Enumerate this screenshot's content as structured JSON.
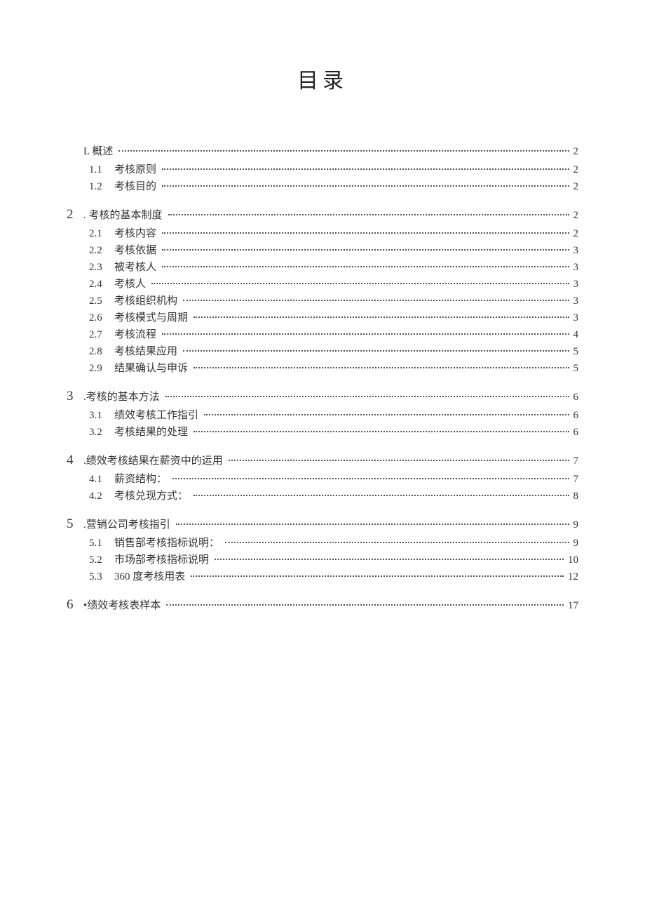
{
  "title": "目录",
  "toc": [
    {
      "level": 1,
      "num": "",
      "label": "L 概述",
      "page": "2"
    },
    {
      "level": 2,
      "num": "1.1",
      "label": "考核原则",
      "page": "2"
    },
    {
      "level": 2,
      "num": "1.2",
      "label": "考核目的",
      "page": "2"
    },
    {
      "level": 1,
      "num": "2",
      "label": ". 考核的基本制度",
      "page": "2"
    },
    {
      "level": 2,
      "num": "2.1",
      "label": "考核内容",
      "page": "2"
    },
    {
      "level": 2,
      "num": "2.2",
      "label": "考核依据",
      "page": "3"
    },
    {
      "level": 2,
      "num": "2.3",
      "label": "被考核人",
      "page": "3"
    },
    {
      "level": 2,
      "num": "2.4",
      "label": "考核人",
      "page": "3"
    },
    {
      "level": 2,
      "num": "2.5",
      "label": "考核组织机构",
      "page": "3"
    },
    {
      "level": 2,
      "num": "2.6",
      "label": "考核模式与周期",
      "page": "3"
    },
    {
      "level": 2,
      "num": "2.7",
      "label": "考核流程",
      "page": "4"
    },
    {
      "level": 2,
      "num": "2.8",
      "label": "考核结果应用",
      "page": "5"
    },
    {
      "level": 2,
      "num": "2.9",
      "label": "结果确认与申诉",
      "page": "5"
    },
    {
      "level": 1,
      "num": "3",
      "label": ".考核的基本方法",
      "page": "6"
    },
    {
      "level": 2,
      "num": "3.1",
      "label": "绩效考核工作指引",
      "page": "6"
    },
    {
      "level": 2,
      "num": "3.2",
      "label": "考核结果的处理",
      "page": "6"
    },
    {
      "level": 1,
      "num": "4",
      "label": ".绩效考核结果在薪资中的运用",
      "page": "7"
    },
    {
      "level": 2,
      "num": "4.1",
      "label": "薪资结构：",
      "page": "7"
    },
    {
      "level": 2,
      "num": "4.2",
      "label": "考核兑现方式：",
      "page": "8"
    },
    {
      "level": 1,
      "num": "5",
      "label": ".营销公司考核指引",
      "page": "9"
    },
    {
      "level": 2,
      "num": "5.1",
      "label": "销售部考核指标说明：",
      "page": "9"
    },
    {
      "level": 2,
      "num": "5.2",
      "label": "市场部考核指标说明",
      "page": "10"
    },
    {
      "level": 2,
      "num": "5.3",
      "label": "360 度考核用表",
      "page": "12"
    },
    {
      "level": 1,
      "num": "6",
      "label": "•绩效考核表样本",
      "page": "17"
    }
  ]
}
